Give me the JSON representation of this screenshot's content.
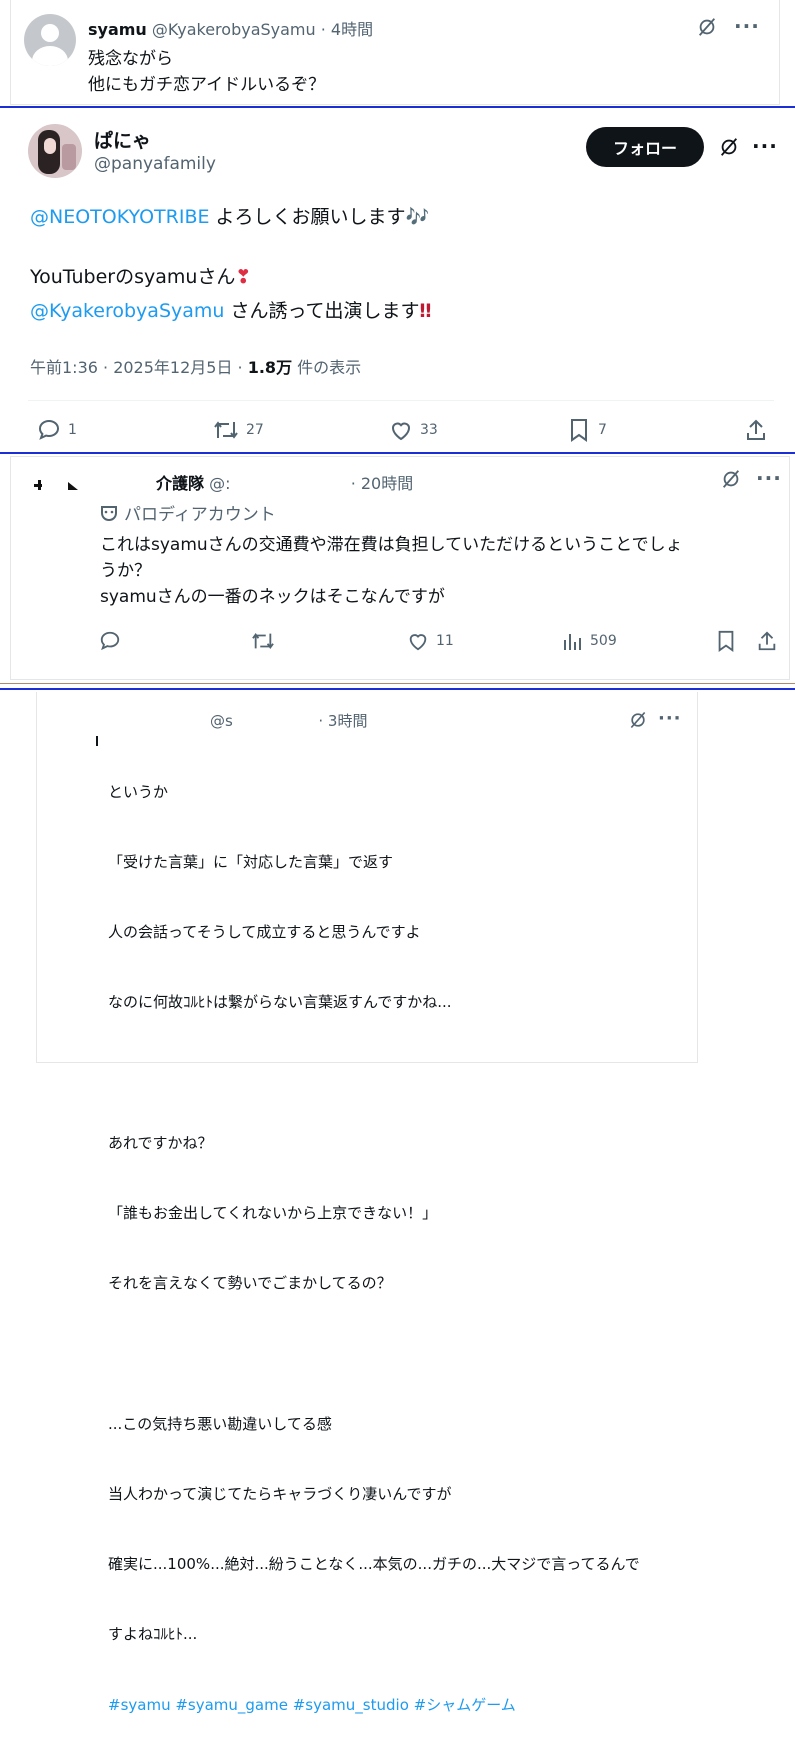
{
  "post1": {
    "name": "syamu",
    "handle": "@KyakerobyaSyamu",
    "time": "· 4時間",
    "lines": [
      "残念ながら",
      "他にもガチ恋アイドルいるぞ？"
    ]
  },
  "post2": {
    "name": "ぱにゃ",
    "handle": "@panyafamily",
    "follow_label": "フォロー",
    "mention1": "@NEOTOKYOTRIBE",
    "line1_rest": " よろしくお願いします",
    "line1_emoji": "🎶",
    "line2": "YouTuberのsyamuさん",
    "line2_emoji": "❣",
    "mention2": "@KyakerobyaSyamu",
    "line3_rest": " さん誘って出演します",
    "line3_emoji": "‼",
    "meta_time": "午前1:36 · 2025年12月5日 · ",
    "views_count": "1.8万",
    "views_label": " 件の表示",
    "replies": "1",
    "reposts": "27",
    "likes": "33",
    "bookmarks": "7"
  },
  "post3": {
    "name": "介護隊",
    "handle_partial": "@:",
    "time": "· 20時間",
    "parody_label": "パロディアカウント",
    "text1": "これはsyamuさんの交通費や滞在費は負担していただけるということでしょ",
    "text2": "うか？",
    "text3": "syamuさんの一番のネックはそこなんですが",
    "likes": "11",
    "views": "509"
  },
  "post4": {
    "handle_partial": "@s",
    "time": "· 3時間",
    "lines": [
      "というか",
      "「受けた言葉」に「対応した言葉」で返す",
      "人の会話ってそうして成立すると思うんですよ",
      "なのに何故ｺﾙﾋﾄは繋がらない言葉返すんですかね...",
      "",
      "あれですかね？",
      "「誰もお金出してくれないから上京できない！」",
      "それを言えなくて勢いでごまかしてるの？",
      "",
      "...この気持ち悪い勘違いしてる感",
      "当人わかって演じてたらキャラづくり凄いんですが",
      "確実に...100%...絶対...紛うことなく...本気の...ガチの...大マジで言ってるんで",
      "すよねｺﾙﾋﾄ..."
    ],
    "hashtags": "#syamu #syamu_game #syamu_studio #シャムゲーム"
  },
  "colors": {
    "link": "#1d9bf0",
    "separator": "#1c2fd6",
    "text": "#0f1419",
    "muted": "#536471"
  }
}
